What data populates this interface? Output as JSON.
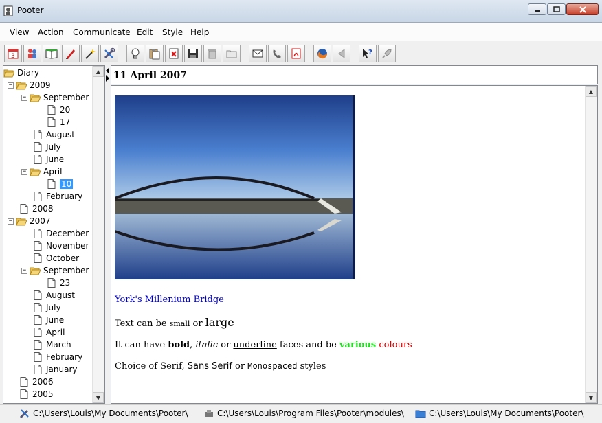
{
  "window": {
    "title": "Pooter"
  },
  "menu": [
    "View",
    "Action",
    "Communicate",
    "Edit",
    "Style",
    "Help"
  ],
  "toolbar": [
    "calendar-icon",
    "people-icon",
    "book-icon",
    "pen-icon",
    "wand-icon",
    "tools-icon",
    "bulb-icon",
    "paste-icon",
    "delete-doc-icon",
    "save-icon",
    "trash-icon",
    "folder-icon",
    "mail-icon",
    "phone-icon",
    "pdf-icon",
    "firefox-icon",
    "back-icon",
    "help-icon",
    "rocket-icon"
  ],
  "tree": {
    "root": "Diary",
    "y2009": "2009",
    "sep09": "September",
    "d20": "20",
    "d17": "17",
    "aug09": "August",
    "jul09": "July",
    "jun09": "June",
    "apr09": "April",
    "d10": "10",
    "feb09": "February",
    "y2008": "2008",
    "y2007": "2007",
    "dec07": "December",
    "nov07": "November",
    "oct07": "October",
    "sep07": "September",
    "d23": "23",
    "aug07": "August",
    "jul07": "July",
    "jun07": "June",
    "apr07": "April",
    "mar07": "March",
    "feb07": "February",
    "jan07": "January",
    "y2006": "2006",
    "y2005": "2005"
  },
  "entry": {
    "date": "11 April 2007",
    "caption": "York's Millenium Bridge",
    "size": {
      "a": "Text can be ",
      "small": "small",
      "b": " or ",
      "large": "large"
    },
    "faces": {
      "a": "It can have ",
      "bold": "bold",
      "b": ", ",
      "italic": "italic",
      "c": " or ",
      "underline": "underline",
      "d": " faces and be ",
      "various": "various",
      "e": " ",
      "colours": "colours"
    },
    "fonts": {
      "a": "Choice of Serif, ",
      "sans": "Sans Serif",
      "b": " or ",
      "mono": "Monospaced",
      "c": " styles"
    },
    "colors": {
      "caption": "#0000cc",
      "green": "#22dd22",
      "red": "#e00000"
    }
  },
  "status": {
    "p1": "C:\\Users\\Louis\\My Documents\\Pooter\\",
    "p2": "C:\\Users\\Louis\\Program Files\\Pooter\\modules\\",
    "p3": "C:\\Users\\Louis\\My Documents\\Pooter\\"
  }
}
